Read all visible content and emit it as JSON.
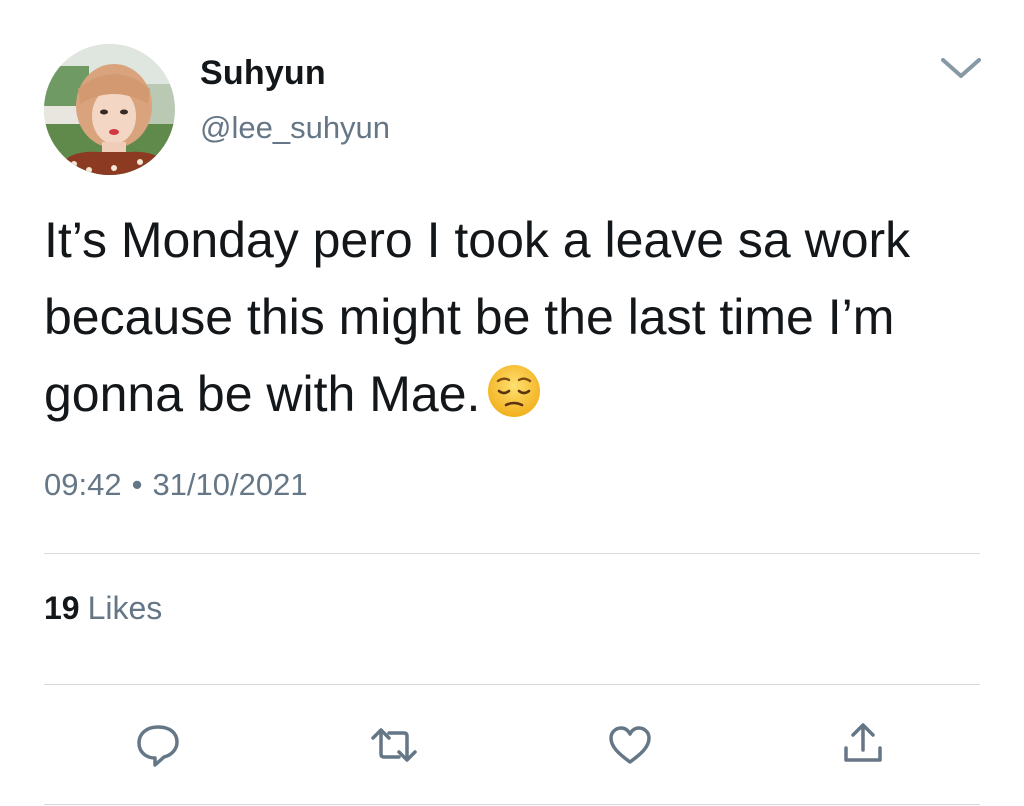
{
  "user": {
    "display_name": "Suhyun",
    "handle": "@lee_suhyun"
  },
  "tweet": {
    "text": "It’s Monday pero I took a leave sa work because this might be the last time I’m gonna be with Mae.",
    "emoji_icon": "pensive-face-emoji",
    "time": "09:42",
    "separator": "•",
    "date": "31/10/2021"
  },
  "stats": {
    "likes_count": "19",
    "likes_label": "Likes"
  },
  "actions": {
    "reply_icon": "reply-icon",
    "retweet_icon": "retweet-icon",
    "like_icon": "heart-icon",
    "share_icon": "share-icon"
  },
  "colors": {
    "text_primary": "#14171a",
    "text_secondary": "#657786",
    "icon": "#657786",
    "divider": "#d6dadd"
  }
}
